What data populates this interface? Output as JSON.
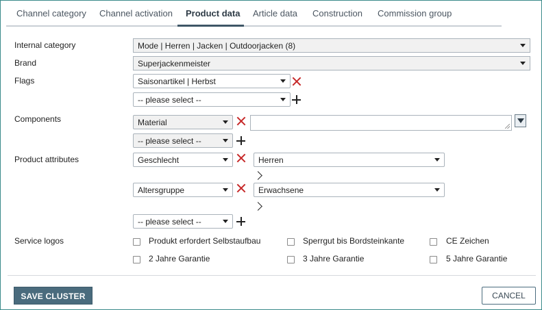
{
  "tabs": [
    {
      "label": "Channel category"
    },
    {
      "label": "Channel activation"
    },
    {
      "label": "Product data"
    },
    {
      "label": "Article data"
    },
    {
      "label": "Construction"
    },
    {
      "label": "Commission group"
    }
  ],
  "active_tab": "Product data",
  "form": {
    "internal_category": {
      "label": "Internal category",
      "value": "Mode | Herren | Jacken | Outdoorjacken (8)"
    },
    "brand": {
      "label": "Brand",
      "value": "Superjackenmeister"
    },
    "flags": {
      "label": "Flags",
      "selected": "Saisonartikel | Herbst",
      "add_placeholder": "-- please select --"
    },
    "components": {
      "label": "Components",
      "selected": "Material",
      "text_value": "",
      "add_placeholder": "-- please select --"
    },
    "product_attributes": {
      "label": "Product attributes",
      "items": [
        {
          "attribute": "Geschlecht",
          "value": "Herren"
        },
        {
          "attribute": "Altersgruppe",
          "value": "Erwachsene"
        }
      ],
      "add_placeholder": "-- please select --"
    },
    "service_logos": {
      "label": "Service logos",
      "options": [
        {
          "label": "Produkt erfordert Selbstaufbau",
          "checked": false
        },
        {
          "label": "Sperrgut bis Bordsteinkante",
          "checked": false
        },
        {
          "label": "CE Zeichen",
          "checked": false
        },
        {
          "label": "2 Jahre Garantie",
          "checked": false
        },
        {
          "label": "3 Jahre Garantie",
          "checked": false
        },
        {
          "label": "5 Jahre Garantie",
          "checked": false
        }
      ]
    }
  },
  "actions": {
    "save_label": "SAVE CLUSTER",
    "cancel_label": "CANCEL"
  }
}
